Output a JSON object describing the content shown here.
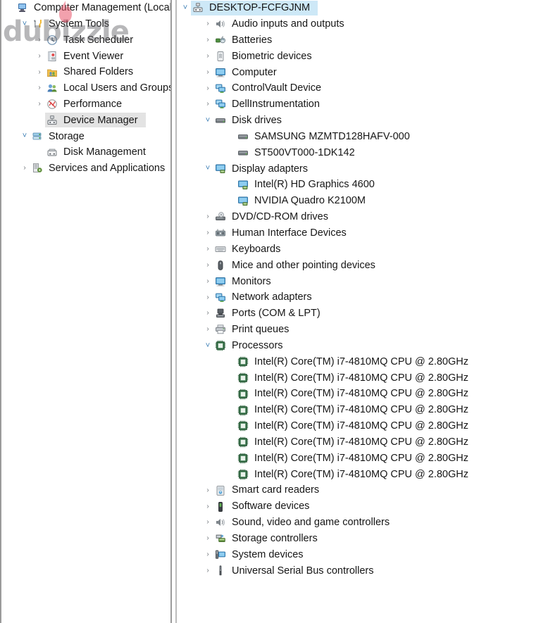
{
  "window": {
    "app_name": "Computer Management",
    "watermark_text": "dubizzle"
  },
  "left_tree": {
    "root": {
      "label": "Computer Management (Local)",
      "icon": "computer-management-icon"
    },
    "items": [
      {
        "label": "System Tools",
        "icon": "system-tools-icon",
        "indent": 1,
        "state": "expanded",
        "selected": false
      },
      {
        "label": "Task Scheduler",
        "icon": "task-scheduler-icon",
        "indent": 2,
        "state": "collapsed",
        "selected": false
      },
      {
        "label": "Event Viewer",
        "icon": "event-viewer-icon",
        "indent": 2,
        "state": "collapsed",
        "selected": false
      },
      {
        "label": "Shared Folders",
        "icon": "shared-folders-icon",
        "indent": 2,
        "state": "collapsed",
        "selected": false
      },
      {
        "label": "Local Users and Groups",
        "icon": "local-users-groups-icon",
        "indent": 2,
        "state": "collapsed",
        "selected": false
      },
      {
        "label": "Performance",
        "icon": "performance-icon",
        "indent": 2,
        "state": "collapsed",
        "selected": false
      },
      {
        "label": "Device Manager",
        "icon": "device-manager-icon",
        "indent": 2,
        "state": "leaf",
        "selected": true
      },
      {
        "label": "Storage",
        "icon": "storage-icon",
        "indent": 1,
        "state": "expanded",
        "selected": false
      },
      {
        "label": "Disk Management",
        "icon": "disk-management-icon",
        "indent": 2,
        "state": "leaf",
        "selected": false
      },
      {
        "label": "Services and Applications",
        "icon": "services-applications-icon",
        "indent": 1,
        "state": "collapsed",
        "selected": false
      }
    ]
  },
  "device_tree": {
    "root": {
      "label": "DESKTOP-FCFGJNM",
      "icon": "computer-node-icon",
      "state": "expanded",
      "selected": true
    },
    "items": [
      {
        "label": "Audio inputs and outputs",
        "icon": "speaker-icon",
        "indent": 1,
        "state": "collapsed"
      },
      {
        "label": "Batteries",
        "icon": "battery-icon",
        "indent": 1,
        "state": "collapsed"
      },
      {
        "label": "Biometric devices",
        "icon": "fingerprint-icon",
        "indent": 1,
        "state": "collapsed"
      },
      {
        "label": "Computer",
        "icon": "monitor-icon",
        "indent": 1,
        "state": "collapsed"
      },
      {
        "label": "ControlVault Device",
        "icon": "network-device-icon",
        "indent": 1,
        "state": "collapsed"
      },
      {
        "label": "DellInstrumentation",
        "icon": "network-device-icon",
        "indent": 1,
        "state": "collapsed"
      },
      {
        "label": "Disk drives",
        "icon": "disk-drive-icon",
        "indent": 1,
        "state": "expanded"
      },
      {
        "label": "SAMSUNG MZMTD128HAFV-000",
        "icon": "disk-drive-icon",
        "indent": 2,
        "state": "leaf"
      },
      {
        "label": "ST500VT000-1DK142",
        "icon": "disk-drive-icon",
        "indent": 2,
        "state": "leaf"
      },
      {
        "label": "Display adapters",
        "icon": "display-adapter-icon",
        "indent": 1,
        "state": "expanded"
      },
      {
        "label": "Intel(R) HD Graphics 4600",
        "icon": "display-adapter-icon",
        "indent": 2,
        "state": "leaf"
      },
      {
        "label": "NVIDIA Quadro K2100M",
        "icon": "display-adapter-icon",
        "indent": 2,
        "state": "leaf"
      },
      {
        "label": "DVD/CD-ROM drives",
        "icon": "dvd-drive-icon",
        "indent": 1,
        "state": "collapsed"
      },
      {
        "label": "Human Interface Devices",
        "icon": "hid-icon",
        "indent": 1,
        "state": "collapsed"
      },
      {
        "label": "Keyboards",
        "icon": "keyboard-icon",
        "indent": 1,
        "state": "collapsed"
      },
      {
        "label": "Mice and other pointing devices",
        "icon": "mouse-icon",
        "indent": 1,
        "state": "collapsed"
      },
      {
        "label": "Monitors",
        "icon": "monitor-icon",
        "indent": 1,
        "state": "collapsed"
      },
      {
        "label": "Network adapters",
        "icon": "network-device-icon",
        "indent": 1,
        "state": "collapsed"
      },
      {
        "label": "Ports (COM & LPT)",
        "icon": "port-icon",
        "indent": 1,
        "state": "collapsed"
      },
      {
        "label": "Print queues",
        "icon": "printer-icon",
        "indent": 1,
        "state": "collapsed"
      },
      {
        "label": "Processors",
        "icon": "processor-icon",
        "indent": 1,
        "state": "expanded"
      },
      {
        "label": "Intel(R) Core(TM) i7-4810MQ CPU @ 2.80GHz",
        "icon": "processor-icon",
        "indent": 2,
        "state": "leaf"
      },
      {
        "label": "Intel(R) Core(TM) i7-4810MQ CPU @ 2.80GHz",
        "icon": "processor-icon",
        "indent": 2,
        "state": "leaf"
      },
      {
        "label": "Intel(R) Core(TM) i7-4810MQ CPU @ 2.80GHz",
        "icon": "processor-icon",
        "indent": 2,
        "state": "leaf"
      },
      {
        "label": "Intel(R) Core(TM) i7-4810MQ CPU @ 2.80GHz",
        "icon": "processor-icon",
        "indent": 2,
        "state": "leaf"
      },
      {
        "label": "Intel(R) Core(TM) i7-4810MQ CPU @ 2.80GHz",
        "icon": "processor-icon",
        "indent": 2,
        "state": "leaf"
      },
      {
        "label": "Intel(R) Core(TM) i7-4810MQ CPU @ 2.80GHz",
        "icon": "processor-icon",
        "indent": 2,
        "state": "leaf"
      },
      {
        "label": "Intel(R) Core(TM) i7-4810MQ CPU @ 2.80GHz",
        "icon": "processor-icon",
        "indent": 2,
        "state": "leaf"
      },
      {
        "label": "Intel(R) Core(TM) i7-4810MQ CPU @ 2.80GHz",
        "icon": "processor-icon",
        "indent": 2,
        "state": "leaf"
      },
      {
        "label": "Smart card readers",
        "icon": "smart-card-reader-icon",
        "indent": 1,
        "state": "collapsed"
      },
      {
        "label": "Software devices",
        "icon": "software-device-icon",
        "indent": 1,
        "state": "collapsed"
      },
      {
        "label": "Sound, video and game controllers",
        "icon": "speaker-icon",
        "indent": 1,
        "state": "collapsed"
      },
      {
        "label": "Storage controllers",
        "icon": "storage-controller-icon",
        "indent": 1,
        "state": "collapsed"
      },
      {
        "label": "System devices",
        "icon": "system-device-icon",
        "indent": 1,
        "state": "collapsed"
      },
      {
        "label": "Universal Serial Bus controllers",
        "icon": "usb-icon",
        "indent": 1,
        "state": "collapsed"
      }
    ]
  },
  "colors": {
    "selection_active": "#cde8f7",
    "selection_inactive": "#e3e3e3",
    "text": "#161616",
    "twisty_collapsed": "#6f7479",
    "twisty_expanded": "#3d7fb5",
    "pane_border": "#9b9b9b"
  }
}
